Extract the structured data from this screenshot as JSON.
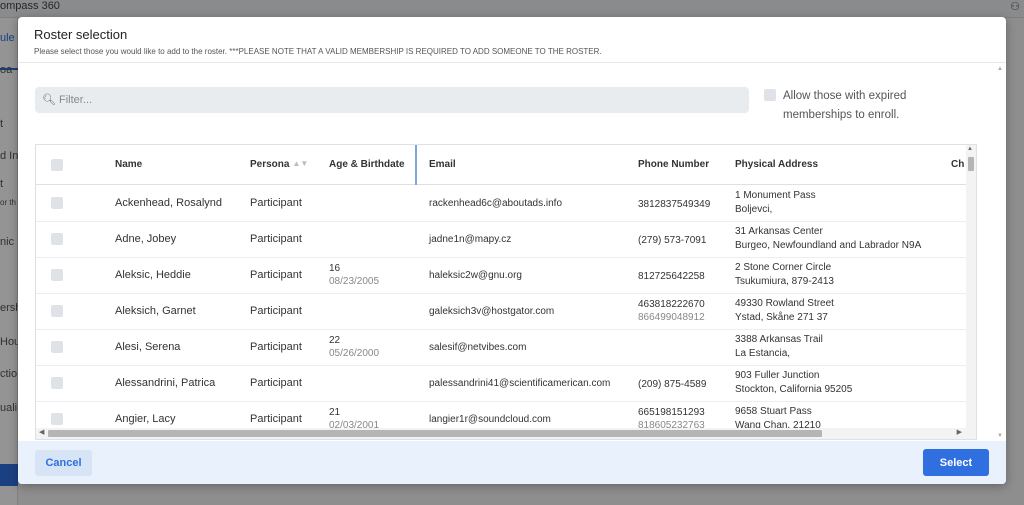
{
  "background": {
    "title_fragment": "ompass 360",
    "sidebar_fragments": [
      "ule",
      "oa",
      "t",
      "d In",
      "t",
      "or th",
      "nic",
      "ersh",
      "Hou",
      "ctio",
      "uali"
    ]
  },
  "modal": {
    "title": "Roster selection",
    "subtitle": "Please select those you would like to add to the roster. ***PLEASE NOTE THAT A VALID MEMBERSHIP IS REQUIRED TO ADD SOMEONE TO THE ROSTER.",
    "filter_placeholder": "Filter...",
    "expired_label": "Allow those with expired memberships to enroll.",
    "columns": {
      "name": "Name",
      "persona": "Persona",
      "age": "Age & Birthdate",
      "email": "Email",
      "phone": "Phone Number",
      "address": "Physical Address",
      "next": "Ch"
    },
    "rows": [
      {
        "name": "Ackenhead, Rosalynd",
        "persona": "Participant",
        "age": "",
        "birthdate": "",
        "email": "rackenhead6c@aboutads.info",
        "phone1": "3812837549349",
        "phone2": "",
        "addr1": "1 Monument Pass",
        "addr2": "Boljevci,"
      },
      {
        "name": "Adne, Jobey",
        "persona": "Participant",
        "age": "",
        "birthdate": "",
        "email": "jadne1n@mapy.cz",
        "phone1": "(279) 573-7091",
        "phone2": "",
        "addr1": "31 Arkansas Center",
        "addr2": "Burgeo, Newfoundland and Labrador N9A"
      },
      {
        "name": "Aleksic, Heddie",
        "persona": "Participant",
        "age": "16",
        "birthdate": "08/23/2005",
        "email": "haleksic2w@gnu.org",
        "phone1": "812725642258",
        "phone2": "",
        "addr1": "2 Stone Corner Circle",
        "addr2": "Tsukumiura, 879-2413"
      },
      {
        "name": "Aleksich, Garnet",
        "persona": "Participant",
        "age": "",
        "birthdate": "",
        "email": "galeksich3v@hostgator.com",
        "phone1": "463818222670",
        "phone2": "866499048912",
        "addr1": "49330 Rowland Street",
        "addr2": "Ystad, Skåne 271 37"
      },
      {
        "name": "Alesi, Serena",
        "persona": "Participant",
        "age": "22",
        "birthdate": "05/26/2000",
        "email": "salesif@netvibes.com",
        "phone1": "",
        "phone2": "",
        "addr1": "3388 Arkansas Trail",
        "addr2": "La Estancia,"
      },
      {
        "name": "Alessandrini, Patrica",
        "persona": "Participant",
        "age": "",
        "birthdate": "",
        "email": "palessandrini41@scientificamerican.com",
        "phone1": "(209) 875-4589",
        "phone2": "",
        "addr1": "903 Fuller Junction",
        "addr2": "Stockton, California 95205"
      },
      {
        "name": "Angier, Lacy",
        "persona": "Participant",
        "age": "21",
        "birthdate": "02/03/2001",
        "email": "langier1r@soundcloud.com",
        "phone1": "665198151293",
        "phone2": "818605232763",
        "addr1": "9658 Stuart Pass",
        "addr2": "Wang Chan, 21210"
      }
    ],
    "cancel_label": "Cancel",
    "select_label": "Select"
  }
}
